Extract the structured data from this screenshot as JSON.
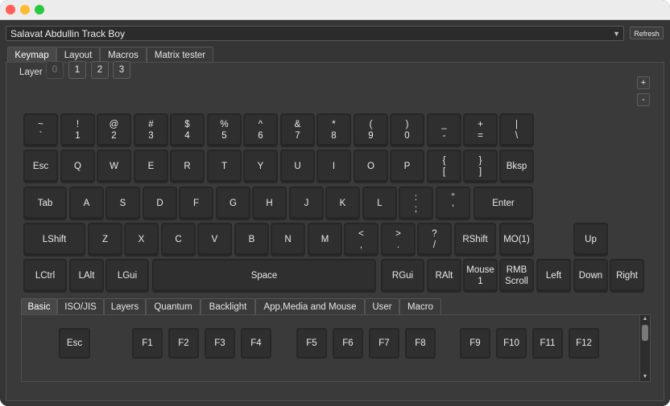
{
  "device": {
    "selected": "Salavat Abdullin Track Boy",
    "refresh_label": "Refresh"
  },
  "tabs": [
    "Keymap",
    "Layout",
    "Macros",
    "Matrix tester"
  ],
  "active_tab": "Keymap",
  "layer": {
    "label": "Layer",
    "buttons": [
      "0",
      "1",
      "2",
      "3"
    ],
    "active": "0"
  },
  "layer_controls": {
    "add": "+",
    "remove": "-"
  },
  "keyboard_rows": [
    [
      [
        "~",
        "`"
      ],
      [
        "!",
        "1"
      ],
      [
        "@",
        "2"
      ],
      [
        "#",
        "3"
      ],
      [
        "$",
        "4"
      ],
      [
        "%",
        "5"
      ],
      [
        "^",
        "6"
      ],
      [
        "&",
        "7"
      ],
      [
        "*",
        "8"
      ],
      [
        "(",
        "9"
      ],
      [
        ")",
        "0"
      ],
      [
        "_",
        "-"
      ],
      [
        "+",
        "="
      ],
      [
        "|",
        "\\"
      ]
    ],
    [
      [
        "Esc"
      ],
      [
        "Q"
      ],
      [
        "W"
      ],
      [
        "E"
      ],
      [
        "R"
      ],
      [
        "T"
      ],
      [
        "Y"
      ],
      [
        "U"
      ],
      [
        "I"
      ],
      [
        "O"
      ],
      [
        "P"
      ],
      [
        "{",
        "["
      ],
      [
        "}",
        "]"
      ],
      [
        "Bksp"
      ]
    ],
    [
      [
        "Tab"
      ],
      [
        "A"
      ],
      [
        "S"
      ],
      [
        "D"
      ],
      [
        "F"
      ],
      [
        "G"
      ],
      [
        "H"
      ],
      [
        "J"
      ],
      [
        "K"
      ],
      [
        "L"
      ],
      [
        ":",
        ";"
      ],
      [
        "\"",
        "'"
      ],
      [
        "Enter"
      ]
    ],
    [
      [
        "LShift"
      ],
      [
        "Z"
      ],
      [
        "X"
      ],
      [
        "C"
      ],
      [
        "V"
      ],
      [
        "B"
      ],
      [
        "N"
      ],
      [
        "M"
      ],
      [
        "<",
        ","
      ],
      [
        ">",
        "."
      ],
      [
        "?",
        "/"
      ],
      [
        "RShift"
      ],
      [
        "MO(1)"
      ],
      [
        "Up"
      ]
    ],
    [
      [
        "LCtrl"
      ],
      [
        "LAlt"
      ],
      [
        "LGui"
      ],
      [
        "Space"
      ],
      [
        "RGui"
      ],
      [
        "RAlt"
      ],
      [
        "Mouse",
        "1"
      ],
      [
        "RMB",
        "Scroll"
      ],
      [
        "Left"
      ],
      [
        "Down"
      ],
      [
        "Right"
      ]
    ]
  ],
  "keycode_tabs": [
    "Basic",
    "ISO/JIS",
    "Layers",
    "Quantum",
    "Backlight",
    "App,Media and Mouse",
    "User",
    "Macro"
  ],
  "active_keycode_tab": "Basic",
  "basic_keys": [
    "Esc",
    "F1",
    "F2",
    "F3",
    "F4",
    "F5",
    "F6",
    "F7",
    "F8",
    "F9",
    "F10",
    "F11",
    "F12"
  ]
}
